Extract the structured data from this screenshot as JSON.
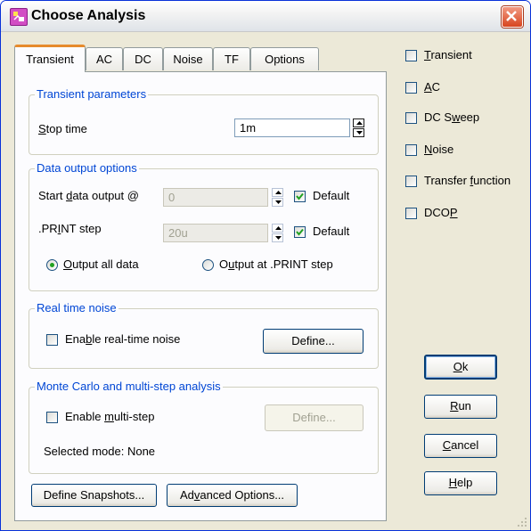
{
  "window": {
    "title": "Choose Analysis"
  },
  "tabs": [
    "Transient",
    "AC",
    "DC",
    "Noise",
    "TF",
    "Options"
  ],
  "transient_parameters": {
    "group_title": "Transient parameters",
    "stop_time_label_pre": "",
    "stop_time_label_mn": "S",
    "stop_time_label_post": "top time",
    "stop_time_value": "1m"
  },
  "data_output": {
    "group_title": "Data output options",
    "start_label_pre": "Start ",
    "start_label_mn": "d",
    "start_label_post": "ata output @",
    "start_value": "0",
    "default_label": "Default",
    "print_label_pre": ".PR",
    "print_label_mn": "I",
    "print_label_post": "NT step",
    "print_value": "20u",
    "default_label_2": "Default",
    "radio_all_pre": "",
    "radio_all_mn": "O",
    "radio_all_post": "utput all data",
    "radio_print_pre": "O",
    "radio_print_mn": "u",
    "radio_print_post": "tput at .PRINT step"
  },
  "realtime_noise": {
    "group_title": "Real time noise",
    "enable_pre": "Ena",
    "enable_mn": "b",
    "enable_post": "le real-time noise",
    "define_label": "Define..."
  },
  "monte_carlo": {
    "group_title": "Monte Carlo and multi-step analysis",
    "enable_pre": "Enable ",
    "enable_mn": "m",
    "enable_post": "ulti-step",
    "define_label": "Define...",
    "selected_mode": "Selected mode: None"
  },
  "bottom_buttons": {
    "snapshots": "Define Snapshots...",
    "advanced_pre": "Ad",
    "advanced_mn": "v",
    "advanced_post": "anced Options..."
  },
  "analysis_checkboxes": [
    {
      "pre": "",
      "mn": "T",
      "post": "ransient"
    },
    {
      "pre": "",
      "mn": "A",
      "post": "C"
    },
    {
      "pre": "DC S",
      "mn": "w",
      "post": "eep"
    },
    {
      "pre": "",
      "mn": "N",
      "post": "oise"
    },
    {
      "pre": "Transfer ",
      "mn": "f",
      "post": "unction"
    },
    {
      "pre": "DCO",
      "mn": "P",
      "post": ""
    }
  ],
  "action_buttons": {
    "ok_mn": "O",
    "ok_post": "k",
    "run_mn": "R",
    "run_post": "un",
    "cancel_mn": "C",
    "cancel_post": "ancel",
    "help_mn": "H",
    "help_post": "elp"
  },
  "colors": {
    "group_title": "#0046d5",
    "active_tab_accent": "#e68b2c",
    "checkmark": "#21a121",
    "dialog_bg": "#ece9d8"
  }
}
